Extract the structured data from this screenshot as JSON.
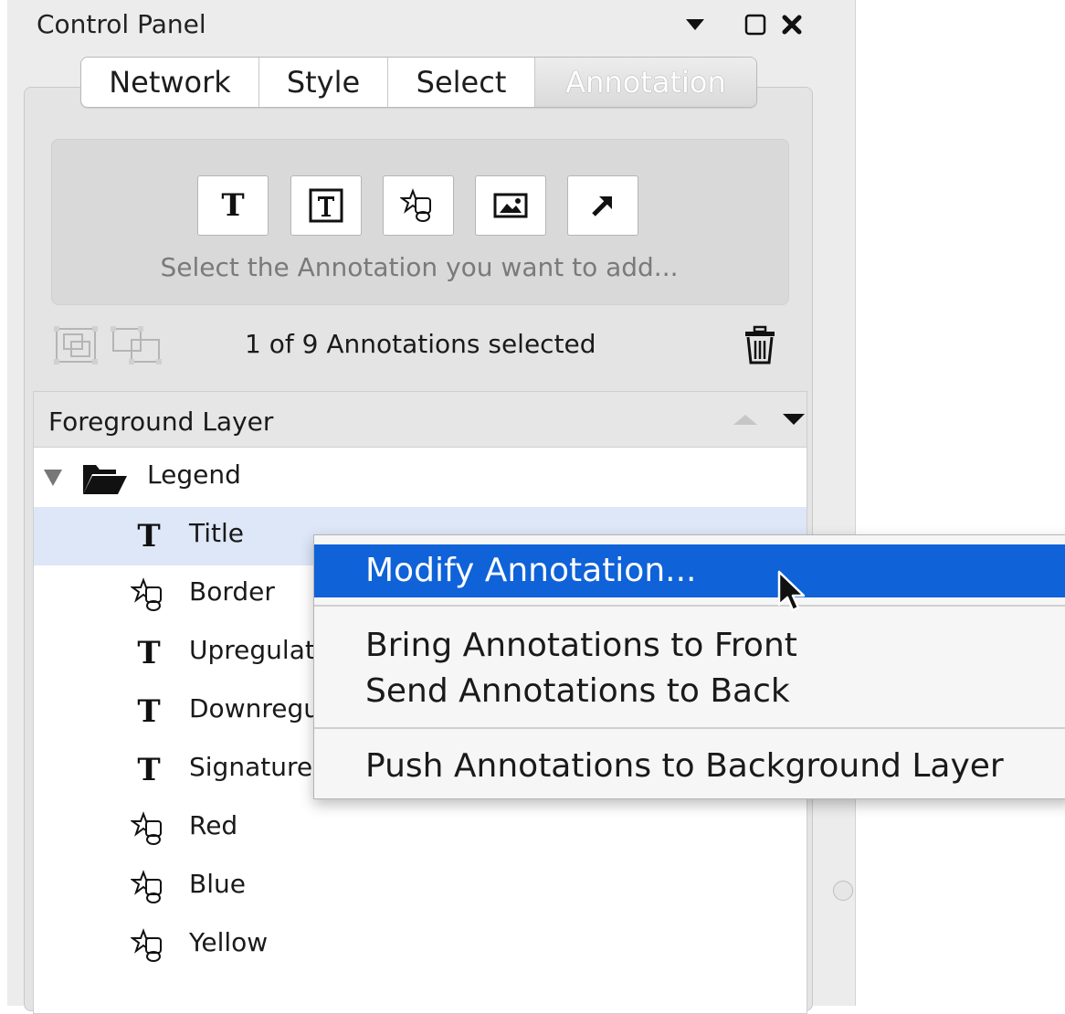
{
  "panel": {
    "title": "Control Panel",
    "header_icons": [
      "dropdown-arrow-icon",
      "maximize-icon",
      "close-icon"
    ]
  },
  "tabs": [
    {
      "label": "Network",
      "selected": false
    },
    {
      "label": "Style",
      "selected": false
    },
    {
      "label": "Select",
      "selected": false
    },
    {
      "label": "Annotation",
      "selected": true
    }
  ],
  "add_annotation": {
    "tools": [
      "text-annotation-icon",
      "bounded-text-annotation-icon",
      "shape-annotation-icon",
      "image-annotation-icon",
      "arrow-annotation-icon"
    ],
    "hint": "Select the Annotation you want to add..."
  },
  "selection": {
    "status": "1 of 9 Annotations selected",
    "icons": [
      "group-icon",
      "ungroup-icon",
      "trash-icon"
    ]
  },
  "layer": {
    "name": "Foreground Layer",
    "group": {
      "name": "Legend",
      "expanded": true
    },
    "items": [
      {
        "label": "Title",
        "type": "text",
        "selected": true
      },
      {
        "label": "Border",
        "type": "shape",
        "selected": false
      },
      {
        "label": "Upregulat",
        "type": "text",
        "selected": false
      },
      {
        "label": "Downregu",
        "type": "text",
        "selected": false
      },
      {
        "label": "Signature",
        "type": "text",
        "selected": false
      },
      {
        "label": "Red",
        "type": "shape",
        "selected": false
      },
      {
        "label": "Blue",
        "type": "shape",
        "selected": false
      },
      {
        "label": "Yellow",
        "type": "shape",
        "selected": false
      }
    ]
  },
  "context_menu": {
    "items": [
      {
        "label": "Modify Annotation...",
        "highlighted": true
      },
      {
        "label": "Bring Annotations to Front",
        "highlighted": false
      },
      {
        "label": "Send Annotations to Back",
        "highlighted": false
      },
      {
        "label": "Push Annotations to Background Layer",
        "highlighted": false
      }
    ]
  },
  "colors": {
    "menu_highlight": "#0f62d8",
    "row_selected": "#dde7f8",
    "panel_bg": "#ececec"
  }
}
